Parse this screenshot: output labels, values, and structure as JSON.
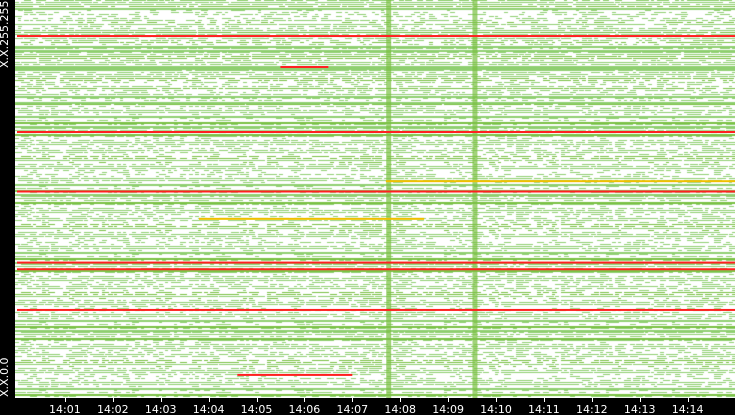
{
  "chart_data": {
    "type": "heatmap",
    "title": "",
    "xlabel": "",
    "ylabel": "",
    "x_range": [
      "14:00",
      "14:15"
    ],
    "xticks": [
      "14:01",
      "14:02",
      "14:03",
      "14:04",
      "14:05",
      "14:06",
      "14:07",
      "14:08",
      "14:09",
      "14:10",
      "14:11",
      "14:12",
      "14:13",
      "14:14"
    ],
    "y_labels": {
      "top": "X.X.255.255",
      "bottom": "X.X.0.0"
    },
    "y_range": [
      0,
      65535
    ],
    "colors": {
      "low": "#8fcf70",
      "mid": "#7ac143",
      "high": "#f0c000",
      "max": "#ff2020",
      "bg": "#ffffff"
    },
    "highlight_rows": [
      {
        "y": 59600,
        "from_min": 0,
        "to_min": 15,
        "level": "max"
      },
      {
        "y": 54500,
        "from_min": 5.5,
        "to_min": 6.5,
        "level": "max"
      },
      {
        "y": 43800,
        "from_min": 0,
        "to_min": 15,
        "level": "max"
      },
      {
        "y": 35700,
        "from_min": 7.7,
        "to_min": 15,
        "level": "high"
      },
      {
        "y": 34000,
        "from_min": 0,
        "to_min": 15,
        "level": "max"
      },
      {
        "y": 29500,
        "from_min": 3.8,
        "to_min": 8.5,
        "level": "high"
      },
      {
        "y": 22300,
        "from_min": 0,
        "to_min": 15,
        "level": "max"
      },
      {
        "y": 21200,
        "from_min": 0,
        "to_min": 15,
        "level": "max"
      },
      {
        "y": 14500,
        "from_min": 0,
        "to_min": 15,
        "level": "max"
      },
      {
        "y": 3800,
        "from_min": 4.6,
        "to_min": 7.0,
        "level": "max"
      }
    ],
    "highlight_columns": [
      {
        "x_min": 7.75,
        "level": "mid"
      },
      {
        "x_min": 9.55,
        "level": "mid"
      }
    ]
  }
}
